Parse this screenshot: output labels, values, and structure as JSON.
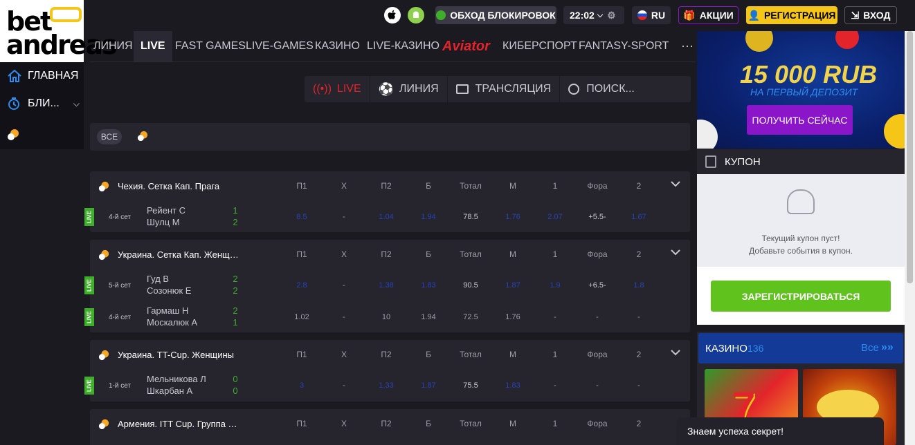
{
  "brand": {
    "line1": "bet",
    "line2": "andreas"
  },
  "topbar": {
    "bypass": "ОБХОД БЛОКИРОВОК",
    "time": "22:02",
    "lang": "RU",
    "promos": "АКЦИИ",
    "register": "РЕГИСТРАЦИЯ",
    "login": "ВХОД",
    "colors": {
      "register_bg": "#f5c518",
      "promos_border": "#8a15c9",
      "bypass_bg": "#3a3945"
    }
  },
  "nav": {
    "items": [
      "ЛИНИЯ",
      "LIVE",
      "FAST GAMES",
      "LIVE-GAMES",
      "КАЗИНО",
      "LIVE-КАЗИНО",
      "Aviator",
      "КИБЕРСПОРТ",
      "FANTASY-SPORT"
    ],
    "active": "LIVE",
    "more": "⋯"
  },
  "sidebar": {
    "items": [
      {
        "label": "ГЛАВНАЯ",
        "icon": "home-icon"
      },
      {
        "label": "БЛИ...",
        "icon": "timer-icon"
      }
    ]
  },
  "filters": {
    "live": "LIVE",
    "line": "ЛИНИЯ",
    "broadcast": "ТРАНСЛЯЦИЯ",
    "search_placeholder": "ПОИСК..."
  },
  "sports_bar": {
    "all": "ВСЕ"
  },
  "columns": [
    "П1",
    "Х",
    "П2",
    "Б",
    "Тотал",
    "М",
    "1",
    "Фора",
    "2"
  ],
  "leagues": [
    {
      "name": "Чехия. Сетка Кап. Прага",
      "matches": [
        {
          "set": "4-й сет",
          "p1": "Рейент С",
          "p2": "Шулц М",
          "s1": "1",
          "s2": "2",
          "odds": [
            "8.5",
            "-",
            "1.04",
            "1.94",
            "78.5",
            "1.76",
            "2.07",
            "+5.5-",
            "1.67"
          ]
        }
      ]
    },
    {
      "name": "Украина. Сетка Кап. Женщи...",
      "matches": [
        {
          "set": "5-й сет",
          "p1": "Гуд В",
          "p2": "Созонюк Е",
          "s1": "2",
          "s2": "2",
          "odds": [
            "2.8",
            "-",
            "1.38",
            "1.83",
            "90.5",
            "1.87",
            "1.9",
            "+6.5-",
            "1.8"
          ]
        },
        {
          "set": "4-й сет",
          "p1": "Гармаш Н",
          "p2": "Москалюк А",
          "s1": "2",
          "s2": "1",
          "odds": [
            "1.02",
            "-",
            "10",
            "1.94",
            "72.5",
            "1.76",
            "-",
            "-",
            "-"
          ]
        }
      ]
    },
    {
      "name": "Украина. TT-Cup. Женщины",
      "matches": [
        {
          "set": "1-й сет",
          "p1": "Мельникова Л",
          "p2": "Шкарбан А",
          "s1": "0",
          "s2": "0",
          "odds": [
            "3",
            "-",
            "1.33",
            "1.87",
            "75.5",
            "1.83",
            "-",
            "-",
            "-"
          ]
        }
      ]
    },
    {
      "name": "Армения. ITT Cup. Группа В. ...",
      "matches": []
    }
  ],
  "live_badge": "LIVE",
  "promo": {
    "amount": "15 000 RUB",
    "subtitle": "НА ПЕРВЫЙ ДЕПОЗИТ",
    "button": "ПОЛУЧИТЬ СЕЙЧАС"
  },
  "coupon": {
    "title": "КУПОН",
    "empty_line1": "Текущий купон пуст!",
    "empty_line2": "Добавьте события в купон.",
    "register": "ЗАРЕГИСТРИРОВАТЬСЯ"
  },
  "casino": {
    "title": "КАЗИНО",
    "count": "136",
    "all": "Все"
  },
  "chat": {
    "text": "Знаем успеха секрет!"
  }
}
